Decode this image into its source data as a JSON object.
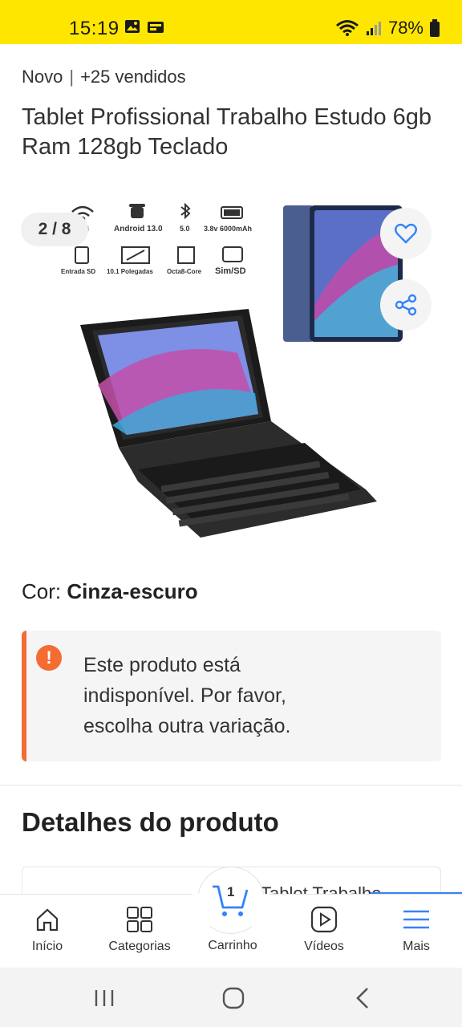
{
  "status_bar": {
    "time": "15:19",
    "battery": "78%"
  },
  "product": {
    "condition": "Novo",
    "sold": "+25 vendidos",
    "title": "Tablet Profissional Trabalho Estudo 6gb Ram 128gb Teclado"
  },
  "gallery": {
    "counter": "2 / 8",
    "specs_row1": [
      "fi",
      "Android 13.0",
      "5.0",
      "3.8v 6000mAh"
    ],
    "specs_row2": [
      "Entrada SD",
      "10.1 Polegadas",
      "Octa8-Core",
      "Sim/SD"
    ]
  },
  "variation": {
    "label": "Cor:",
    "value": "Cinza-escuro"
  },
  "alert": {
    "icon": "exclamation-icon",
    "color": "#f46c32",
    "text": "Este produto está indisponível. Por favor, escolha outra variação."
  },
  "details": {
    "title": "Detalhes do produto",
    "card_peek": "Tablet Trabalho"
  },
  "bottom_nav": {
    "items": [
      {
        "label": "Início",
        "icon": "home-icon"
      },
      {
        "label": "Categorias",
        "icon": "grid-icon"
      },
      {
        "label": "Carrinho",
        "icon": "cart-icon",
        "count": "1"
      },
      {
        "label": "Vídeos",
        "icon": "play-icon"
      },
      {
        "label": "Mais",
        "icon": "menu-icon"
      }
    ]
  },
  "colors": {
    "brand_yellow": "#ffe600",
    "accent_blue": "#3483fa"
  }
}
